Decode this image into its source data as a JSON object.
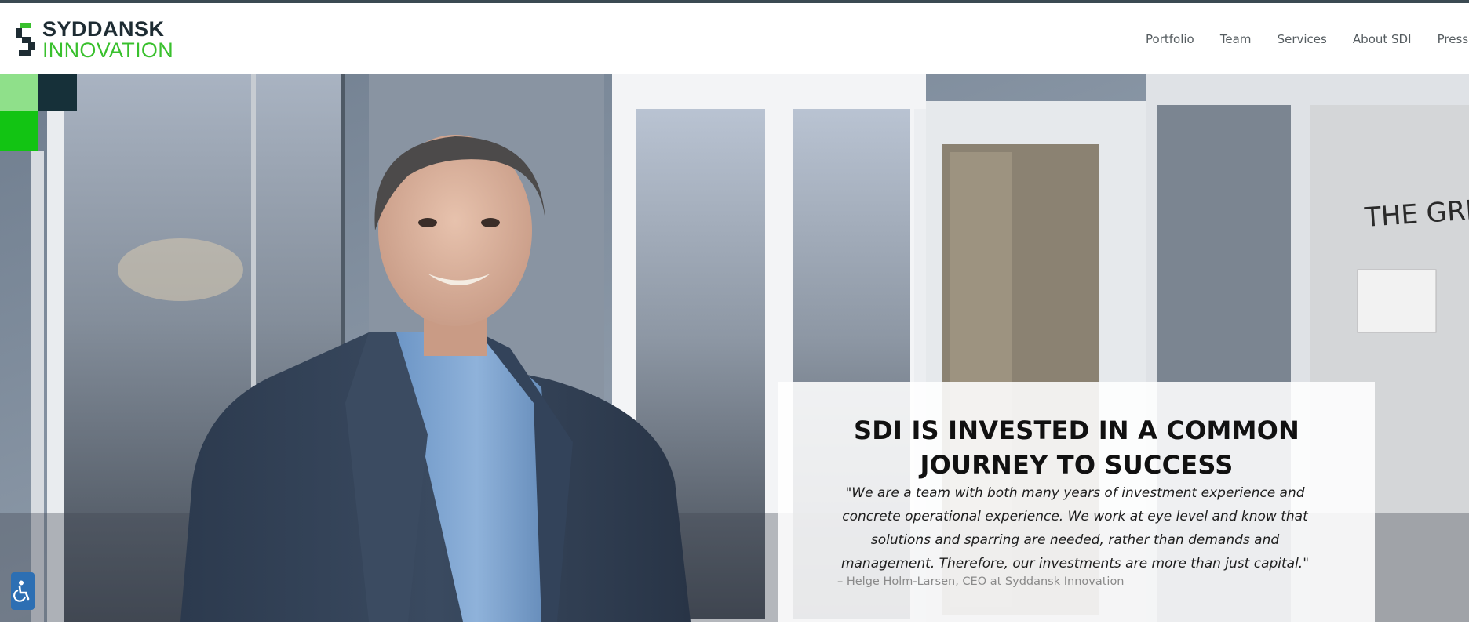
{
  "brand": {
    "name_line1": "SYDDANSK",
    "name_line2": "INNOVATION",
    "colors": {
      "dark": "#1e2c33",
      "green": "#39c02d",
      "bright_green": "#12c413",
      "light_green": "#8fe08a"
    }
  },
  "nav": {
    "items": [
      {
        "label": "Portfolio"
      },
      {
        "label": "Team"
      },
      {
        "label": "Services"
      },
      {
        "label": "About SDI"
      },
      {
        "label": "Press roo"
      }
    ]
  },
  "hero": {
    "heading_line1": "SDI IS INVESTED IN A COMMON",
    "heading_line2": "JOURNEY TO SUCCESS",
    "quote": "\"We are a team with both many years of investment experience and concrete operational experience. We work at eye level and know that solutions and sparring are needed, rather than demands and management. Therefore, our investments are more than just capital.\"",
    "author": "– Helge Holm-Larsen, CEO at Syddansk Innovation",
    "background_text": "THE GRE"
  },
  "icons": {
    "accessibility": "wheelchair-icon"
  }
}
